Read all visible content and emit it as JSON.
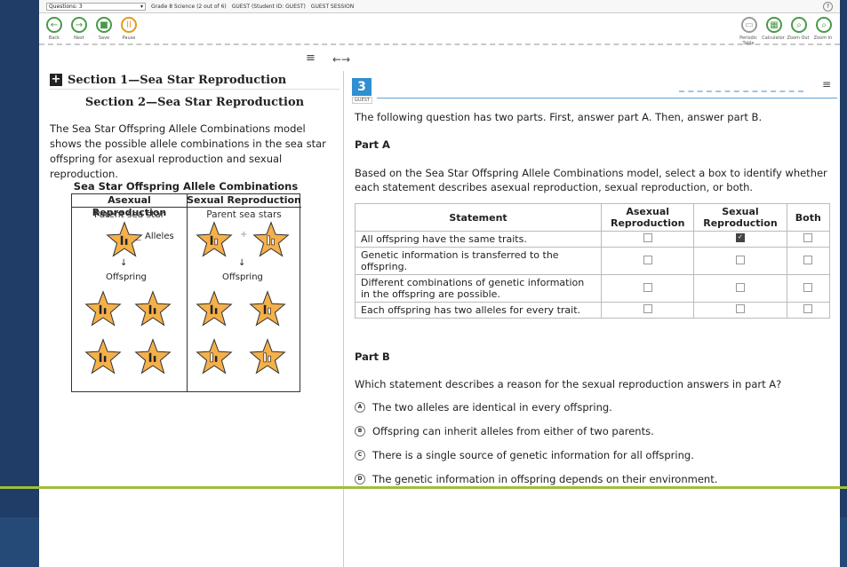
{
  "topbar": {
    "question_select": "Questions: 3",
    "test_info": "Grade 8 Science (2 out of 6)",
    "student_info": "GUEST (Student ID: GUEST)",
    "session_info": "GUEST SESSION"
  },
  "toolbar": {
    "back_label": "Back",
    "next_label": "Next",
    "save_label": "Save",
    "pause_label": "Pause",
    "periodic_label": "Periodic Table",
    "calculator_label": "Calculator",
    "zoom_out_label": "Zoom Out",
    "zoom_in_label": "Zoom In"
  },
  "left": {
    "section1_title": "Section 1—Sea Star Reproduction",
    "section2_title": "Section 2—Sea Star Reproduction",
    "intro": "The Sea Star Offspring Allele Combinations model shows the possible allele combinations in the sea star offspring for asexual reproduction and sexual reproduction.",
    "model_title": "Sea Star Offspring Allele Combinations",
    "col1_header": "Asexual Reproduction",
    "col2_header": "Sexual Reproduction",
    "col1_sub": "Parent sea star",
    "col2_sub": "Parent sea stars",
    "alleles_label": "Alleles",
    "offspring_label": "Offspring",
    "plus_sign": "+"
  },
  "question": {
    "number": "3",
    "guest_tag": "GUEST",
    "instructions": "The following question has two parts. First, answer part A. Then, answer part B.",
    "part_a_title": "Part A",
    "part_a_prompt": "Based on the Sea Star Offspring Allele Combinations model, select a box to identify whether each statement describes asexual reproduction, sexual reproduction, or both.",
    "table_headers": [
      "Statement",
      "Asexual Reproduction",
      "Sexual Reproduction",
      "Both"
    ],
    "rows": [
      {
        "statement": "All offspring have the same traits.",
        "asexual": false,
        "sexual": true,
        "both": false
      },
      {
        "statement": "Genetic information is transferred to the offspring.",
        "asexual": false,
        "sexual": false,
        "both": false
      },
      {
        "statement": "Different combinations of genetic information in the offspring are possible.",
        "asexual": false,
        "sexual": false,
        "both": false
      },
      {
        "statement": "Each offspring has two alleles for every trait.",
        "asexual": false,
        "sexual": false,
        "both": false
      }
    ],
    "part_b_title": "Part B",
    "part_b_prompt": "Which statement describes a reason for the sexual reproduction answers in part A?",
    "options": [
      {
        "letter": "A",
        "text": "The two alleles are identical in every offspring."
      },
      {
        "letter": "B",
        "text": "Offspring can inherit alleles from either of two parents."
      },
      {
        "letter": "C",
        "text": "There is a single source of genetic information for all offspring."
      },
      {
        "letter": "D",
        "text": "The genetic information in offspring depends on their environment."
      }
    ]
  },
  "colors": {
    "frame": "#1f3d66",
    "accent_green": "#9fbf3b",
    "question_blue": "#2f8fcf",
    "star_fill": "#f5b04a"
  }
}
